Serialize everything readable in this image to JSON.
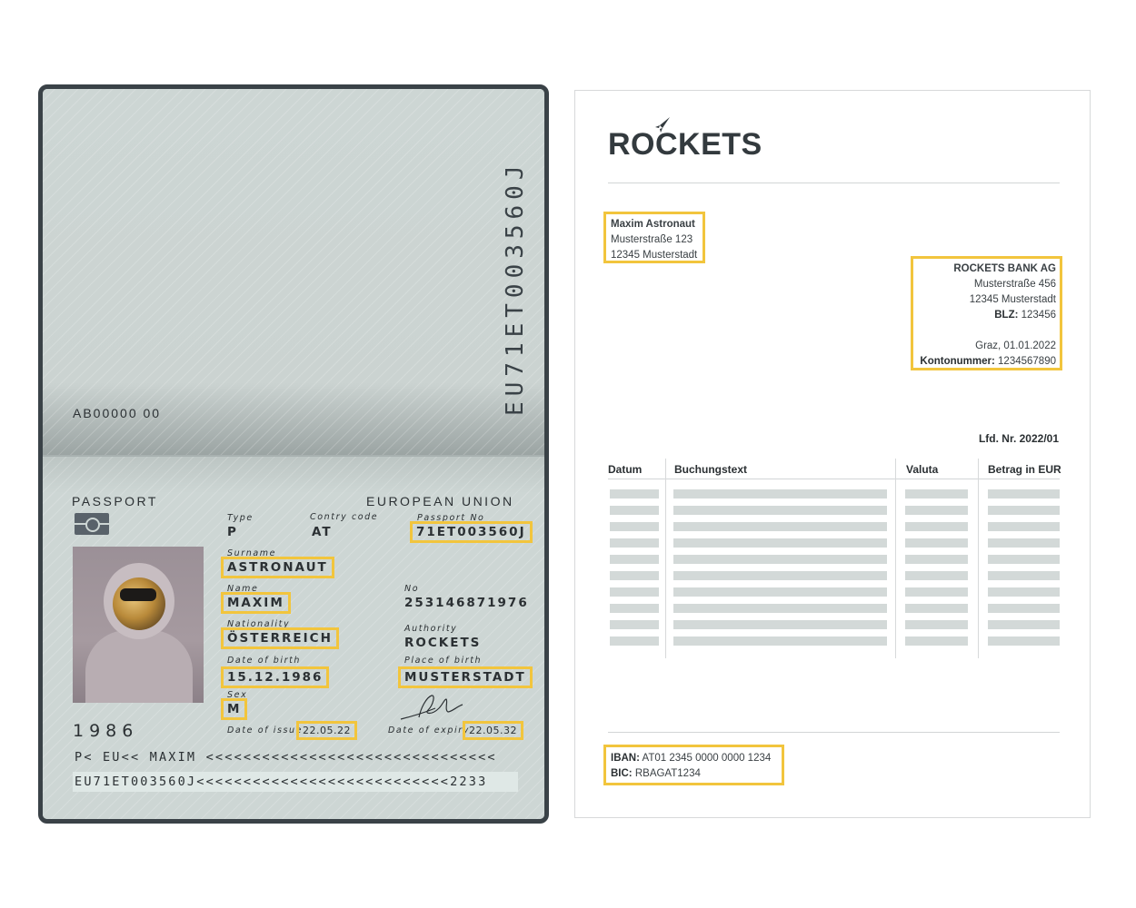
{
  "passport": {
    "vertical_number": "EU71ET003560J",
    "serial": "AB00000 00",
    "title": "PASSPORT",
    "union": "EUROPEAN UNION",
    "type": {
      "label": "Type",
      "value": "P"
    },
    "country_code": {
      "label": "Contry code",
      "value": "AT"
    },
    "passport_no": {
      "label": "Passport No",
      "value": "71ET003560J"
    },
    "surname": {
      "label": "Surname",
      "value": "ASTRONAUT"
    },
    "name": {
      "label": "Name",
      "value": "MAXIM"
    },
    "no": {
      "label": "No",
      "value": "253146871976"
    },
    "nationality": {
      "label": "Nationality",
      "value": "ÖSTERREICH"
    },
    "authority": {
      "label": "Authority",
      "value": "ROCKETS"
    },
    "date_of_birth": {
      "label": "Date of birth",
      "value": "15.12.1986"
    },
    "place_of_birth": {
      "label": "Place of birth",
      "value": "MUSTERSTADT"
    },
    "sex": {
      "label": "Sex",
      "value": "M"
    },
    "year": "1986",
    "date_of_issue": {
      "label": "Date of issue",
      "value": "22.05.22"
    },
    "date_of_expiry": {
      "label": "Date of expiry",
      "value": "22.05.32"
    },
    "mrz_line1": "P< EU<< MAXIM <<<<<<<<<<<<<<<<<<<<<<<<<<<<<<<",
    "mrz_line2": "EU71ET003560J<<<<<<<<<<<<<<<<<<<<<<<<<<<2233"
  },
  "statement": {
    "logo": "ROCKETS",
    "sender": {
      "name": "Maxim Astronaut",
      "street": "Musterstraße 123",
      "city": "12345 Musterstadt"
    },
    "bank": {
      "name": "ROCKETS BANK AG",
      "street": "Musterstraße 456",
      "city": "12345 Musterstadt",
      "blz_label": "BLZ:",
      "blz_value": "123456",
      "place_date": "Graz, 01.01.2022",
      "konto_label": "Kontonummer:",
      "konto_value": "1234567890"
    },
    "lfd": "Lfd. Nr. 2022/01",
    "columns": [
      "Datum",
      "Buchungstext",
      "Valuta",
      "Betrag in EUR"
    ],
    "row_count": 10,
    "iban_label": "IBAN:",
    "iban_value": "AT01 2345 0000 0000 1234",
    "bic_label": "BIC:",
    "bic_value": "RBAGAT1234"
  },
  "colors": {
    "highlight": "#f2c53d",
    "passport_bg": "#cdd6d4",
    "passport_border": "#3a4247",
    "table_placeholder": "#d3d9d8"
  }
}
